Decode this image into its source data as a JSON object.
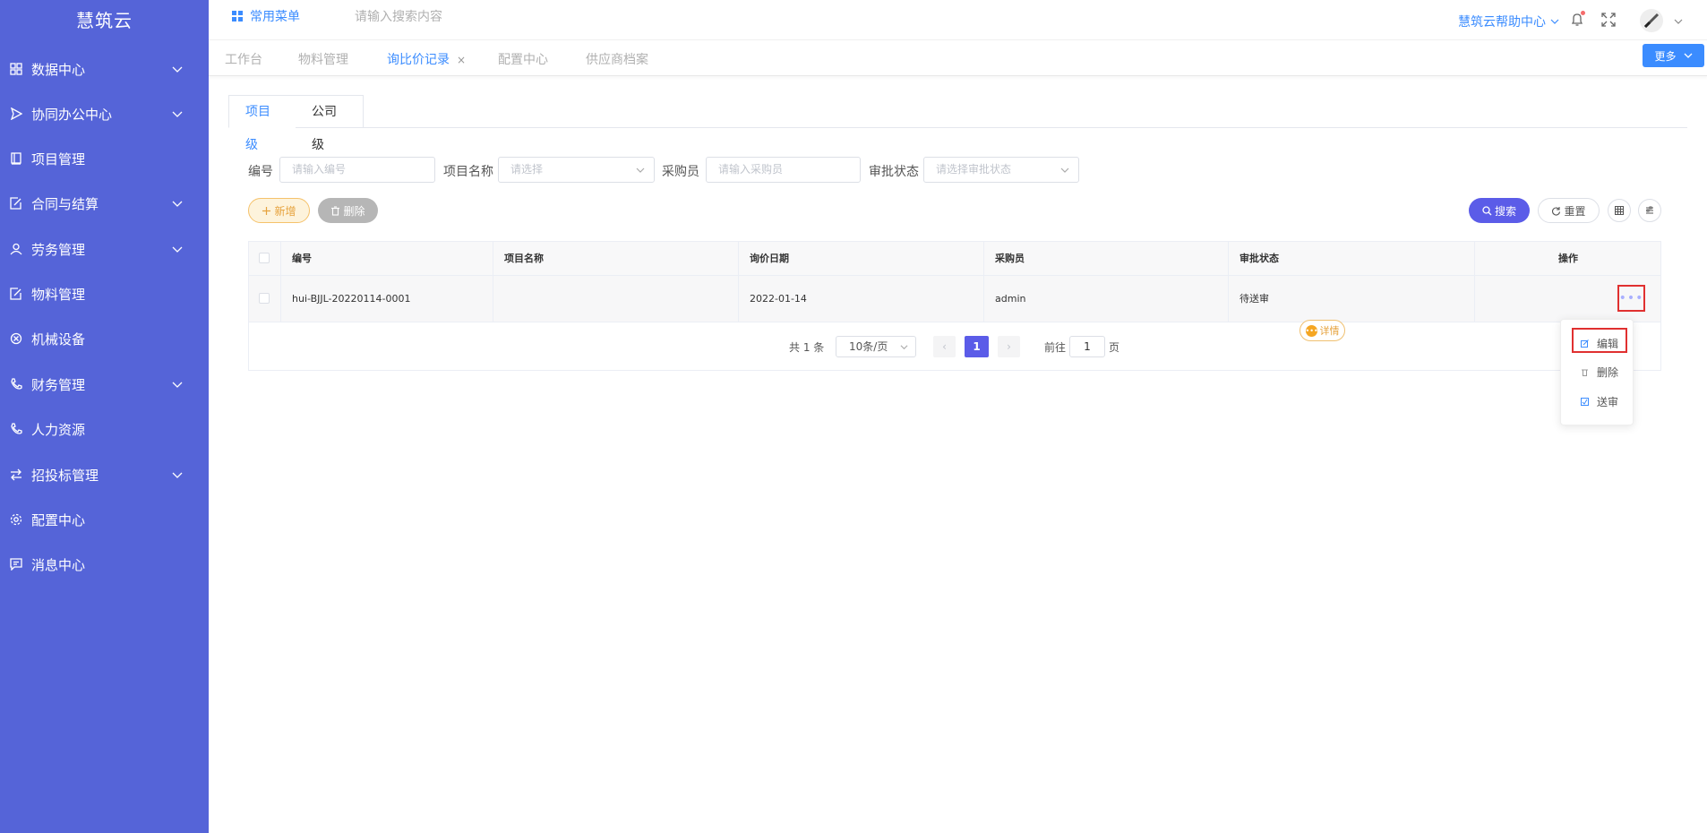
{
  "sidebar": {
    "brand": "慧筑云",
    "items": [
      {
        "label": "数据中心",
        "icon": "grid-icon",
        "expandable": true
      },
      {
        "label": "协同办公中心",
        "icon": "send-icon",
        "expandable": true
      },
      {
        "label": "项目管理",
        "icon": "book-icon",
        "expandable": false
      },
      {
        "label": "合同与结算",
        "icon": "edit-doc-icon",
        "expandable": true
      },
      {
        "label": "劳务管理",
        "icon": "user-icon",
        "expandable": true
      },
      {
        "label": "物料管理",
        "icon": "edit-doc-icon",
        "expandable": false
      },
      {
        "label": "机械设备",
        "icon": "circle-x-icon",
        "expandable": false
      },
      {
        "label": "财务管理",
        "icon": "phone-icon",
        "expandable": true
      },
      {
        "label": "人力资源",
        "icon": "phone-icon",
        "expandable": false
      },
      {
        "label": "招投标管理",
        "icon": "switch-icon",
        "expandable": true
      },
      {
        "label": "配置中心",
        "icon": "gear-icon",
        "expandable": false
      },
      {
        "label": "消息中心",
        "icon": "message-icon",
        "expandable": false
      }
    ]
  },
  "topbar": {
    "common_menu": "常用菜单",
    "search_placeholder": "请输入搜索内容",
    "help": "慧筑云帮助中心"
  },
  "tabs": {
    "items": [
      {
        "label": "工作台",
        "active": false
      },
      {
        "label": "物料管理",
        "active": false
      },
      {
        "label": "询比价记录",
        "active": true,
        "closable": true
      },
      {
        "label": "配置中心",
        "active": false
      },
      {
        "label": "供应商档案",
        "active": false
      }
    ],
    "close_symbol": "×",
    "more": "更多"
  },
  "level_tabs": [
    "项目级",
    "公司级"
  ],
  "filters": {
    "code_label": "编号",
    "code_placeholder": "请输入编号",
    "project_label": "项目名称",
    "project_placeholder": "请选择",
    "buyer_label": "采购员",
    "buyer_placeholder": "请输入采购员",
    "status_label": "审批状态",
    "status_placeholder": "请选择审批状态"
  },
  "actions": {
    "add": "新增",
    "delete": "删除",
    "search": "搜索",
    "reset": "重置"
  },
  "table": {
    "columns": [
      "编号",
      "项目名称",
      "询价日期",
      "采购员",
      "审批状态",
      "操作"
    ],
    "rows": [
      {
        "code": "hui-BJJL-20220114-0001",
        "project": "",
        "date": "2022-01-14",
        "buyer": "admin",
        "status": "待送审",
        "detail": "详情",
        "more": "•••"
      }
    ]
  },
  "pagination": {
    "total": "共 1 条",
    "page_size": "10条/页",
    "prev": "‹",
    "next": "›",
    "current": "1",
    "goto_label": "前往",
    "goto_value": "1",
    "page_suffix": "页"
  },
  "row_menu": {
    "items": [
      "编辑",
      "删除",
      "送审"
    ]
  },
  "colors": {
    "sidebar": "#5564d8",
    "primary": "#3b8cff",
    "accent": "#5b5ce8",
    "warning": "#e6a23c",
    "highlight": "#e03030"
  }
}
